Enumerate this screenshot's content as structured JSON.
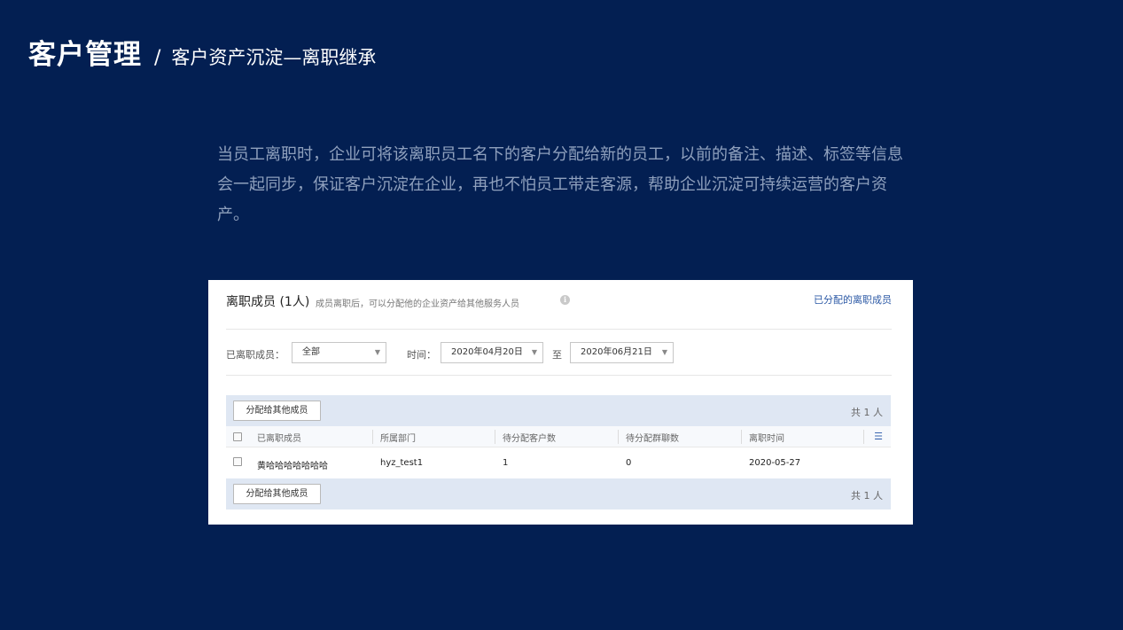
{
  "header": {
    "title": "客户管理",
    "separator": "/",
    "subtitle": "客户资产沉淀—离职继承"
  },
  "intro": "当员工离职时，企业可将该离职员工名下的客户分配给新的员工，以前的备注、描述、标签等信息会一起同步，保证客户沉淀在企业，再也不怕员工带走客源，帮助企业沉淀可持续运营的客户资产。",
  "panel": {
    "title": "离职成员 (1人)",
    "note": "成员离职后，可以分配他的企业资产给其他服务人员",
    "info_icon": "info-icon",
    "assigned_link": "已分配的离职成员",
    "filters": {
      "member_label": "已离职成员：",
      "member_value": "全部",
      "time_label": "时间：",
      "start_date": "2020年04月20日",
      "to_label": "至",
      "end_date": "2020年06月21日"
    },
    "action_button": "分配给其他成员",
    "count": "共 1 人",
    "table": {
      "columns": [
        "已离职成员",
        "所属部门",
        "待分配客户数",
        "待分配群聊数",
        "离职时间"
      ],
      "rows": [
        {
          "name": "黄哈哈哈哈哈哈哈",
          "department": "hyz_test1",
          "customers": "1",
          "groups": "0",
          "date": "2020-05-27"
        }
      ]
    },
    "colors": {
      "background": "#031f52",
      "bar": "#dfe7f3",
      "link": "#2d5aa6"
    }
  }
}
